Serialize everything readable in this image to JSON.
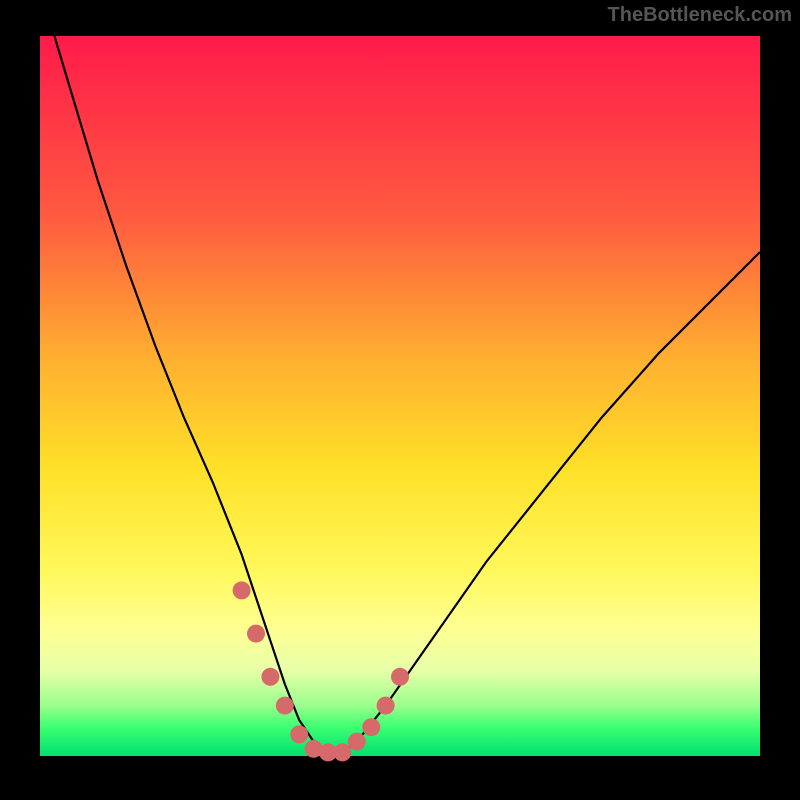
{
  "watermark": "TheBottleneck.com",
  "chart_data": {
    "type": "line",
    "title": "",
    "xlabel": "",
    "ylabel": "",
    "xlim": [
      0,
      100
    ],
    "ylim": [
      0,
      100
    ],
    "grid": false,
    "series": [
      {
        "name": "bottleneck-curve",
        "color": "#000000",
        "x": [
          2,
          5,
          8,
          12,
          16,
          20,
          24,
          28,
          30,
          32,
          34,
          36,
          38,
          40,
          42,
          44,
          48,
          55,
          62,
          70,
          78,
          86,
          94,
          100
        ],
        "values": [
          100,
          90,
          80,
          68,
          57,
          47,
          38,
          28,
          22,
          16,
          10,
          5,
          2,
          0.5,
          0.5,
          2,
          7,
          17,
          27,
          37,
          47,
          56,
          64,
          70
        ]
      }
    ],
    "markers": {
      "color": "#d66a6a",
      "x": [
        28,
        30,
        32,
        34,
        36,
        38,
        40,
        42,
        44,
        46,
        48,
        50
      ],
      "values": [
        23,
        17,
        11,
        7,
        3,
        1,
        0.5,
        0.5,
        2,
        4,
        7,
        11
      ]
    }
  }
}
